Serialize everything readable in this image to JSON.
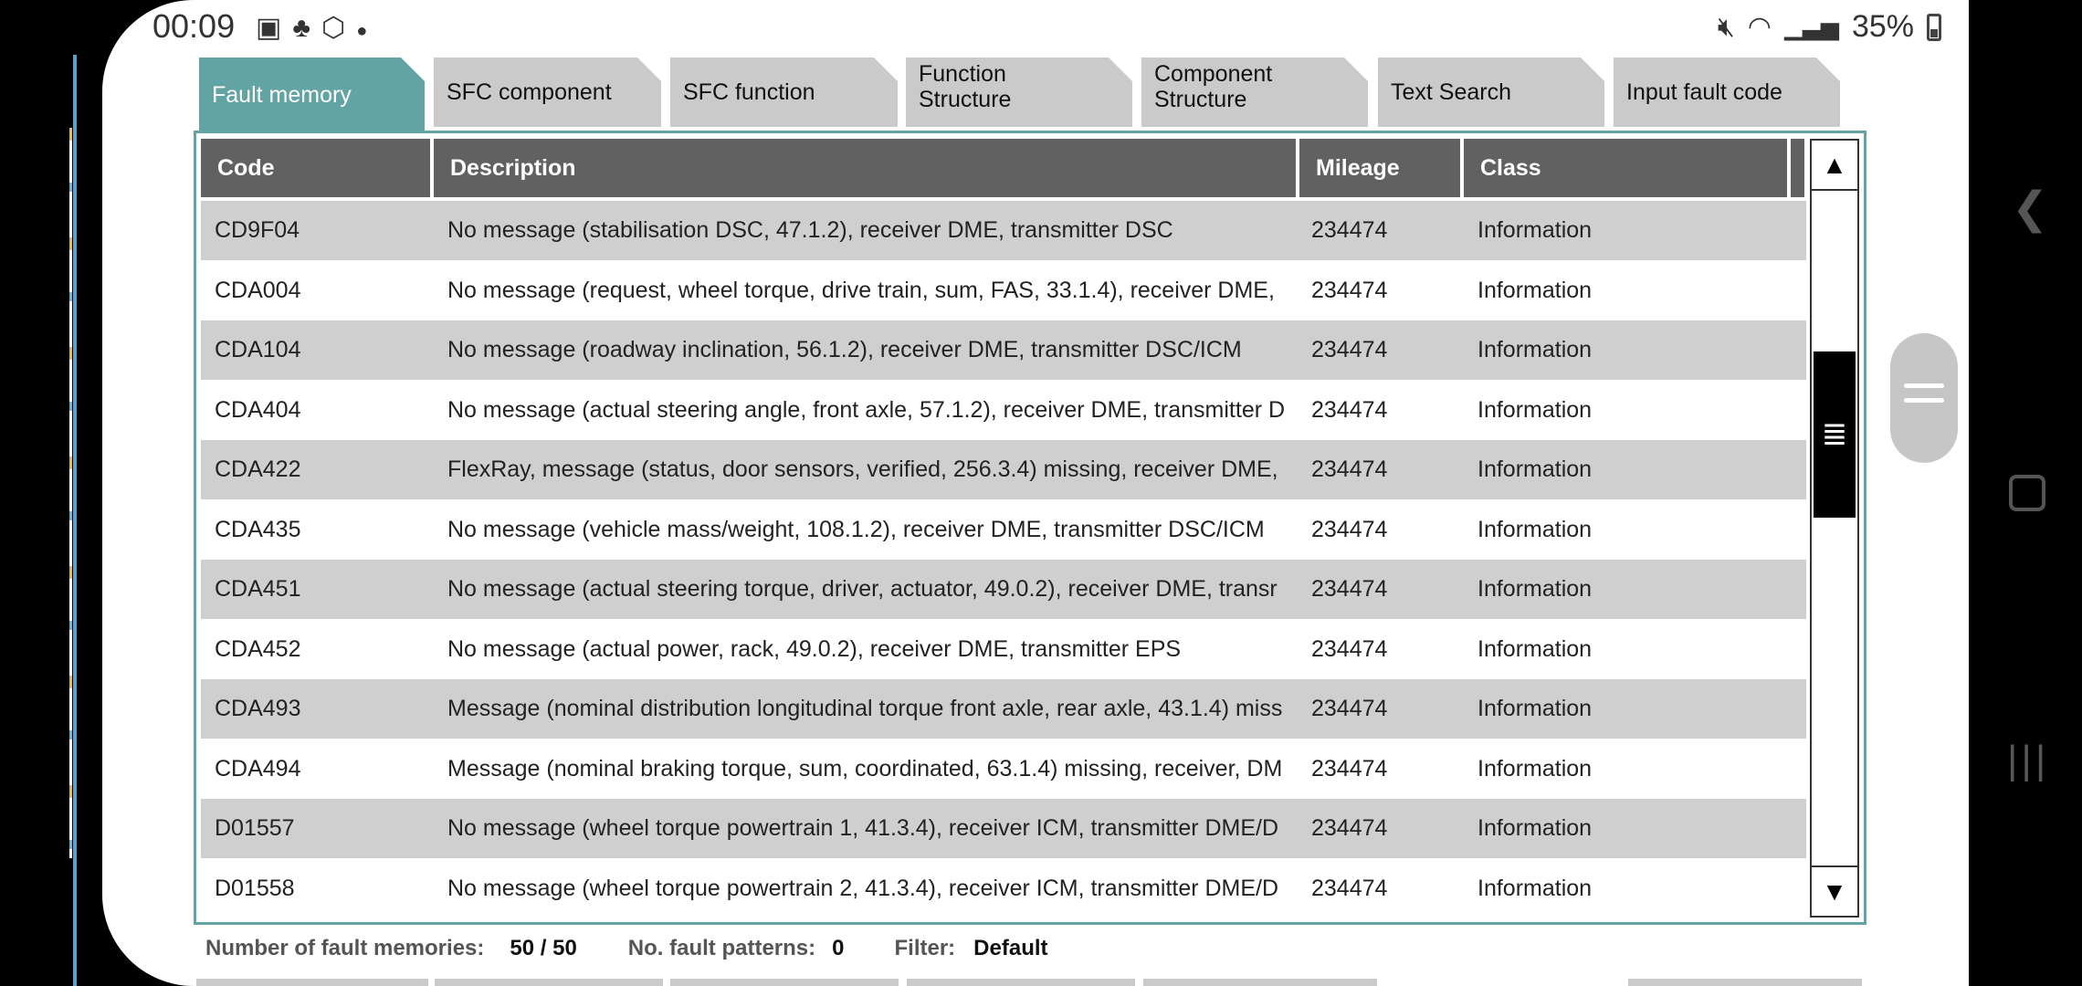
{
  "status_bar": {
    "time": "00:09",
    "left_icons": [
      "gallery-icon",
      "person-icon",
      "settings-icon",
      "dot-icon"
    ],
    "battery": "35%",
    "right_icons": [
      "mute-icon",
      "wifi-icon",
      "signal-icon",
      "battery-icon"
    ]
  },
  "tabs": [
    {
      "label": "Fault memory",
      "active": true
    },
    {
      "label": "SFC component"
    },
    {
      "label": "SFC function"
    },
    {
      "label": "Function\nStructure"
    },
    {
      "label": "Component\nStructure"
    },
    {
      "label": "Text Search"
    },
    {
      "label": "Input fault code"
    }
  ],
  "table": {
    "headers": {
      "code": "Code",
      "description": "Description",
      "mileage": "Mileage",
      "class": "Class"
    },
    "rows": [
      {
        "code": "CD9F04",
        "description": "No message (stabilisation DSC, 47.1.2), receiver DME, transmitter DSC",
        "mileage": "234474",
        "class": "Information"
      },
      {
        "code": "CDA004",
        "description": "No message (request, wheel torque, drive train, sum, FAS, 33.1.4), receiver DME,",
        "mileage": "234474",
        "class": "Information"
      },
      {
        "code": "CDA104",
        "description": "No message (roadway inclination, 56.1.2), receiver DME, transmitter DSC/ICM",
        "mileage": "234474",
        "class": "Information"
      },
      {
        "code": "CDA404",
        "description": "No message (actual steering angle, front axle, 57.1.2), receiver DME, transmitter D",
        "mileage": "234474",
        "class": "Information"
      },
      {
        "code": "CDA422",
        "description": "FlexRay, message (status, door sensors, verified, 256.3.4) missing, receiver DME,",
        "mileage": "234474",
        "class": "Information"
      },
      {
        "code": "CDA435",
        "description": "No message (vehicle mass/weight, 108.1.2), receiver DME, transmitter DSC/ICM",
        "mileage": "234474",
        "class": "Information"
      },
      {
        "code": "CDA451",
        "description": "No message (actual steering torque, driver, actuator, 49.0.2), receiver DME, transr",
        "mileage": "234474",
        "class": "Information"
      },
      {
        "code": "CDA452",
        "description": "No message (actual power, rack, 49.0.2), receiver DME, transmitter EPS",
        "mileage": "234474",
        "class": "Information"
      },
      {
        "code": "CDA493",
        "description": "Message (nominal distribution longitudinal torque front axle, rear axle, 43.1.4) miss",
        "mileage": "234474",
        "class": "Information"
      },
      {
        "code": "CDA494",
        "description": "Message (nominal braking torque, sum, coordinated, 63.1.4) missing, receiver, DM",
        "mileage": "234474",
        "class": "Information"
      },
      {
        "code": "D01557",
        "description": "No message (wheel torque powertrain 1, 41.3.4), receiver ICM, transmitter DME/D",
        "mileage": "234474",
        "class": "Information"
      },
      {
        "code": "D01558",
        "description": "No message (wheel torque powertrain 2, 41.3.4), receiver ICM, transmitter DME/D",
        "mileage": "234474",
        "class": "Information"
      }
    ]
  },
  "footer": {
    "fault_memories_label": "Number of fault memories:",
    "fault_memories_value": "50 / 50",
    "fault_patterns_label": "No. fault patterns:",
    "fault_patterns_value": "0",
    "filter_label": "Filter:",
    "filter_value": "Default"
  },
  "colors": {
    "tab_active": "#62a3a3",
    "tab_inactive": "#cacaca",
    "header_bg": "#616161",
    "row_alt": "#cfcfcf"
  }
}
